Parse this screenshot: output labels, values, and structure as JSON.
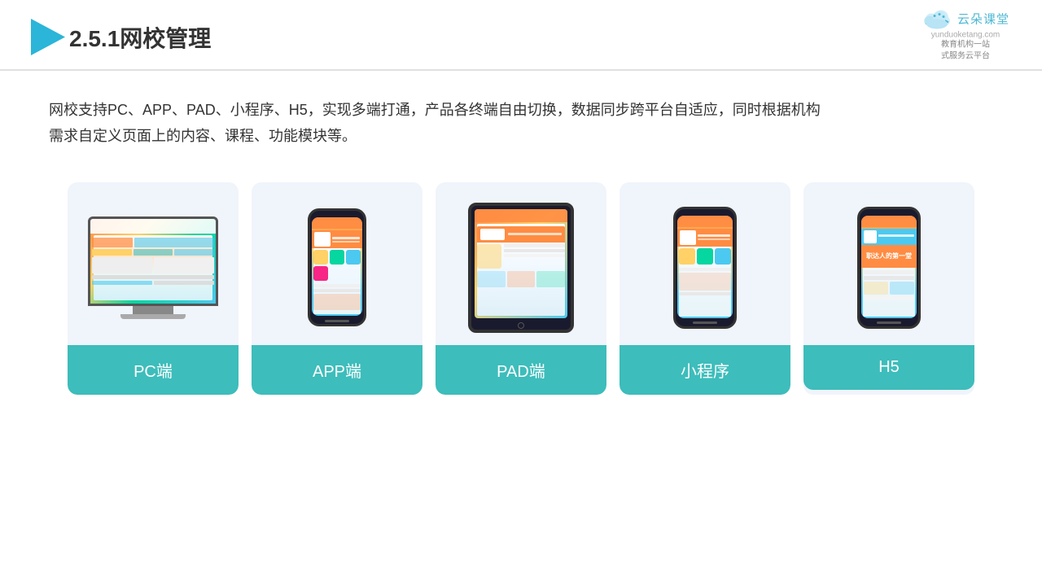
{
  "header": {
    "section_number": "2.5.1",
    "title": "网校管理",
    "brand_name": "云朵课堂",
    "brand_url": "yunduoketang.com",
    "brand_tagline": "教育机构一站\n式服务云平台"
  },
  "description": {
    "text": "网校支持PC、APP、PAD、小程序、H5，实现多端打通，产品各终端自由切换，数据同步跨平台自适应，同时根据机构\n需求自定义页面上的内容、课程、功能模块等。"
  },
  "cards": [
    {
      "id": "pc",
      "label": "PC端"
    },
    {
      "id": "app",
      "label": "APP端"
    },
    {
      "id": "pad",
      "label": "PAD端"
    },
    {
      "id": "miniprogram",
      "label": "小程序"
    },
    {
      "id": "h5",
      "label": "H5"
    }
  ],
  "colors": {
    "teal": "#3dbdbb",
    "accent": "#4db8d4",
    "bg_card": "#f0f4fb",
    "text_primary": "#333333"
  }
}
